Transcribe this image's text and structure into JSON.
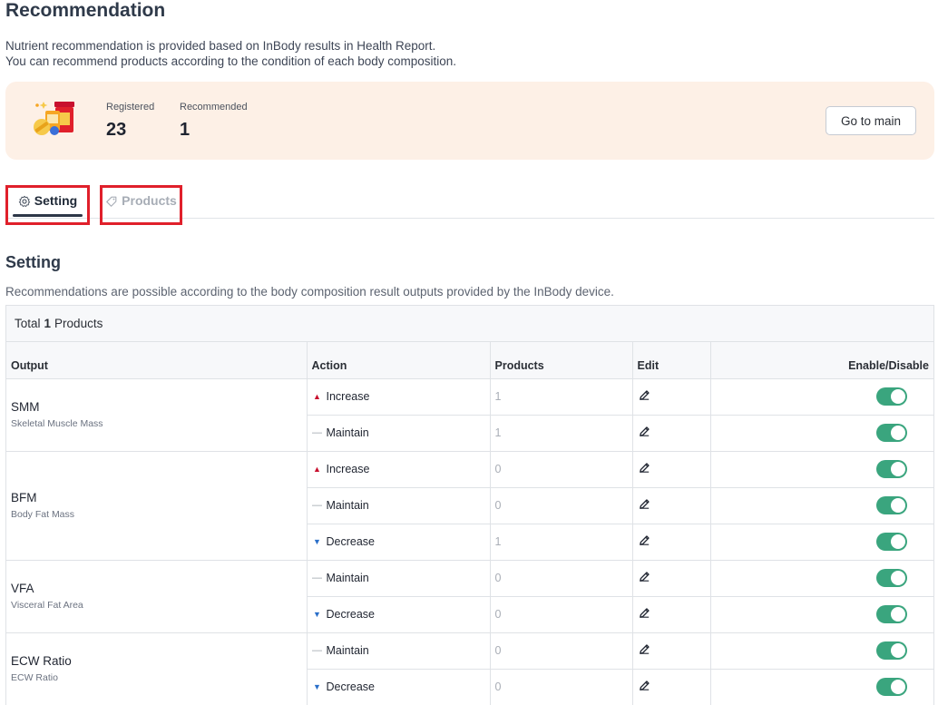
{
  "page": {
    "title": "Recommendation",
    "desc_line1": "Nutrient recommendation is provided based on InBody results in Health Report.",
    "desc_line2": "You can recommend products according to the condition of each body composition."
  },
  "summary": {
    "registered_label": "Registered",
    "registered_value": "23",
    "recommended_label": "Recommended",
    "recommended_value": "1",
    "go_main": "Go to main"
  },
  "tabs": [
    {
      "label": "Setting",
      "icon": "gear-icon",
      "active": true
    },
    {
      "label": "Products",
      "icon": "tag-icon",
      "active": false
    }
  ],
  "section": {
    "title": "Setting",
    "desc": "Recommendations are possible according to the body composition result outputs provided by the InBody device."
  },
  "table": {
    "total_prefix": "Total",
    "total_count": "1",
    "total_suffix": "Products",
    "headers": [
      "Output",
      "Action",
      "Products",
      "Edit",
      "Enable/Disable"
    ],
    "groups": [
      {
        "name": "SMM",
        "full": "Skeletal Muscle Mass",
        "rows": [
          {
            "dir": "up",
            "action": "Increase",
            "products": "1"
          },
          {
            "dir": "flat",
            "action": "Maintain",
            "products": "1"
          }
        ]
      },
      {
        "name": "BFM",
        "full": "Body Fat Mass",
        "rows": [
          {
            "dir": "up",
            "action": "Increase",
            "products": "0"
          },
          {
            "dir": "flat",
            "action": "Maintain",
            "products": "0"
          },
          {
            "dir": "down",
            "action": "Decrease",
            "products": "1"
          }
        ]
      },
      {
        "name": "VFA",
        "full": "Visceral Fat Area",
        "rows": [
          {
            "dir": "flat",
            "action": "Maintain",
            "products": "0"
          },
          {
            "dir": "down",
            "action": "Decrease",
            "products": "0"
          }
        ]
      },
      {
        "name": "ECW Ratio",
        "full": "ECW Ratio",
        "rows": [
          {
            "dir": "flat",
            "action": "Maintain",
            "products": "0"
          },
          {
            "dir": "down",
            "action": "Decrease",
            "products": "0"
          }
        ]
      }
    ]
  },
  "colors": {
    "toggle_on": "#3aa57e",
    "increase": "#c8102e",
    "decrease": "#2a6fc9",
    "card_bg": "#fdf0e6",
    "tab_highlight": "#e0202b"
  }
}
